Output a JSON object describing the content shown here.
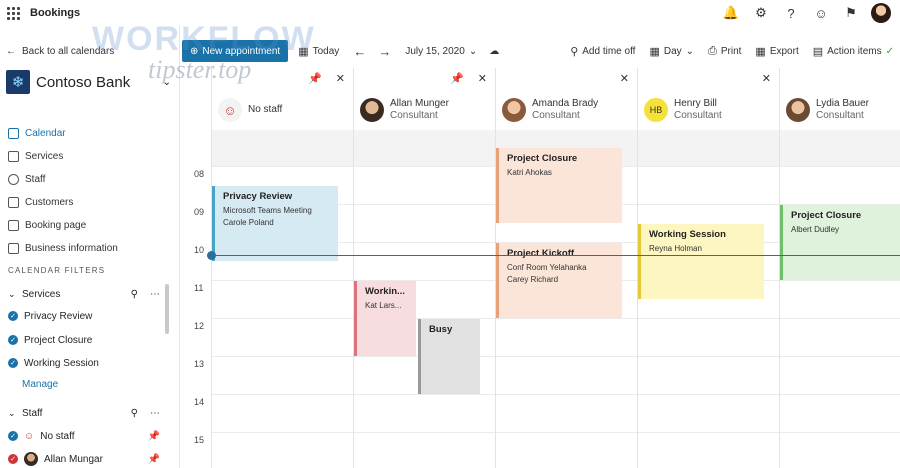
{
  "app": {
    "title": "Bookings"
  },
  "watermark": {
    "line1": "WORKFLOW",
    "line2": "tipster.top"
  },
  "sidebar": {
    "back_label": "Back to all calendars",
    "business_name": "Contoso Bank",
    "nav": [
      {
        "label": "Calendar",
        "icon": "calendar-icon"
      },
      {
        "label": "Services",
        "icon": "services-icon"
      },
      {
        "label": "Staff",
        "icon": "staff-icon"
      },
      {
        "label": "Customers",
        "icon": "customers-icon"
      },
      {
        "label": "Booking page",
        "icon": "booking-page-icon"
      },
      {
        "label": "Business information",
        "icon": "business-info-icon"
      }
    ],
    "filters_heading": "CALENDAR FILTERS",
    "services_heading": "Services",
    "services": [
      "Privacy Review",
      "Project Closure",
      "Working Session"
    ],
    "manage_label": "Manage",
    "staff_heading": "Staff",
    "staff": [
      "No staff",
      "Allan Mungar"
    ]
  },
  "toolbar": {
    "new_label": "New appointment",
    "today_label": "Today",
    "date_label": "July 15, 2020",
    "add_time_off": "Add time off",
    "view_label": "Day",
    "print_label": "Print",
    "export_label": "Export",
    "action_items": "Action items"
  },
  "calendar": {
    "hours": [
      "08",
      "09",
      "10",
      "11",
      "12",
      "13",
      "14",
      "15"
    ],
    "columns": [
      {
        "name": "No staff",
        "role": ""
      },
      {
        "name": "Allan Munger",
        "role": "Consultant"
      },
      {
        "name": "Amanda Brady",
        "role": "Consultant"
      },
      {
        "name": "Henry Bill",
        "role": "Consultant",
        "initials": "HB"
      },
      {
        "name": "Lydia Bauer",
        "role": "Consultant"
      }
    ],
    "events": {
      "privacy": {
        "title": "Privacy Review",
        "line1": "Microsoft Teams Meeting",
        "line2": "Carole Poland"
      },
      "working_allan": {
        "title": "Workin...",
        "line1": "Kat Lars..."
      },
      "busy": {
        "title": "Busy"
      },
      "closure_amanda": {
        "title": "Project Closure",
        "line1": "Katri Ahokas"
      },
      "kickoff": {
        "title": "Project Kickoff",
        "line1": "Conf Room Yelahanka",
        "line2": "Carey Richard"
      },
      "working_henry": {
        "title": "Working Session",
        "line1": "Reyna Holman"
      },
      "closure_lydia": {
        "title": "Project Closure",
        "line1": "Albert Dudley"
      }
    }
  },
  "colors": {
    "accent": "#1a73a8",
    "privacy_bg": "#d6eaf3",
    "privacy_border": "#4aa3c8",
    "working_bg": "#f7dde0",
    "working_border": "#d9737c",
    "busy_bg": "#e1e1e1",
    "busy_border": "#9a9a9a",
    "closure_bg": "#fbe4d8",
    "closure_border": "#e8a27a",
    "henry_bg": "#fdf6c0",
    "henry_border": "#e6c938",
    "lydia_bg": "#dff2dc",
    "lydia_border": "#6cc06a"
  }
}
